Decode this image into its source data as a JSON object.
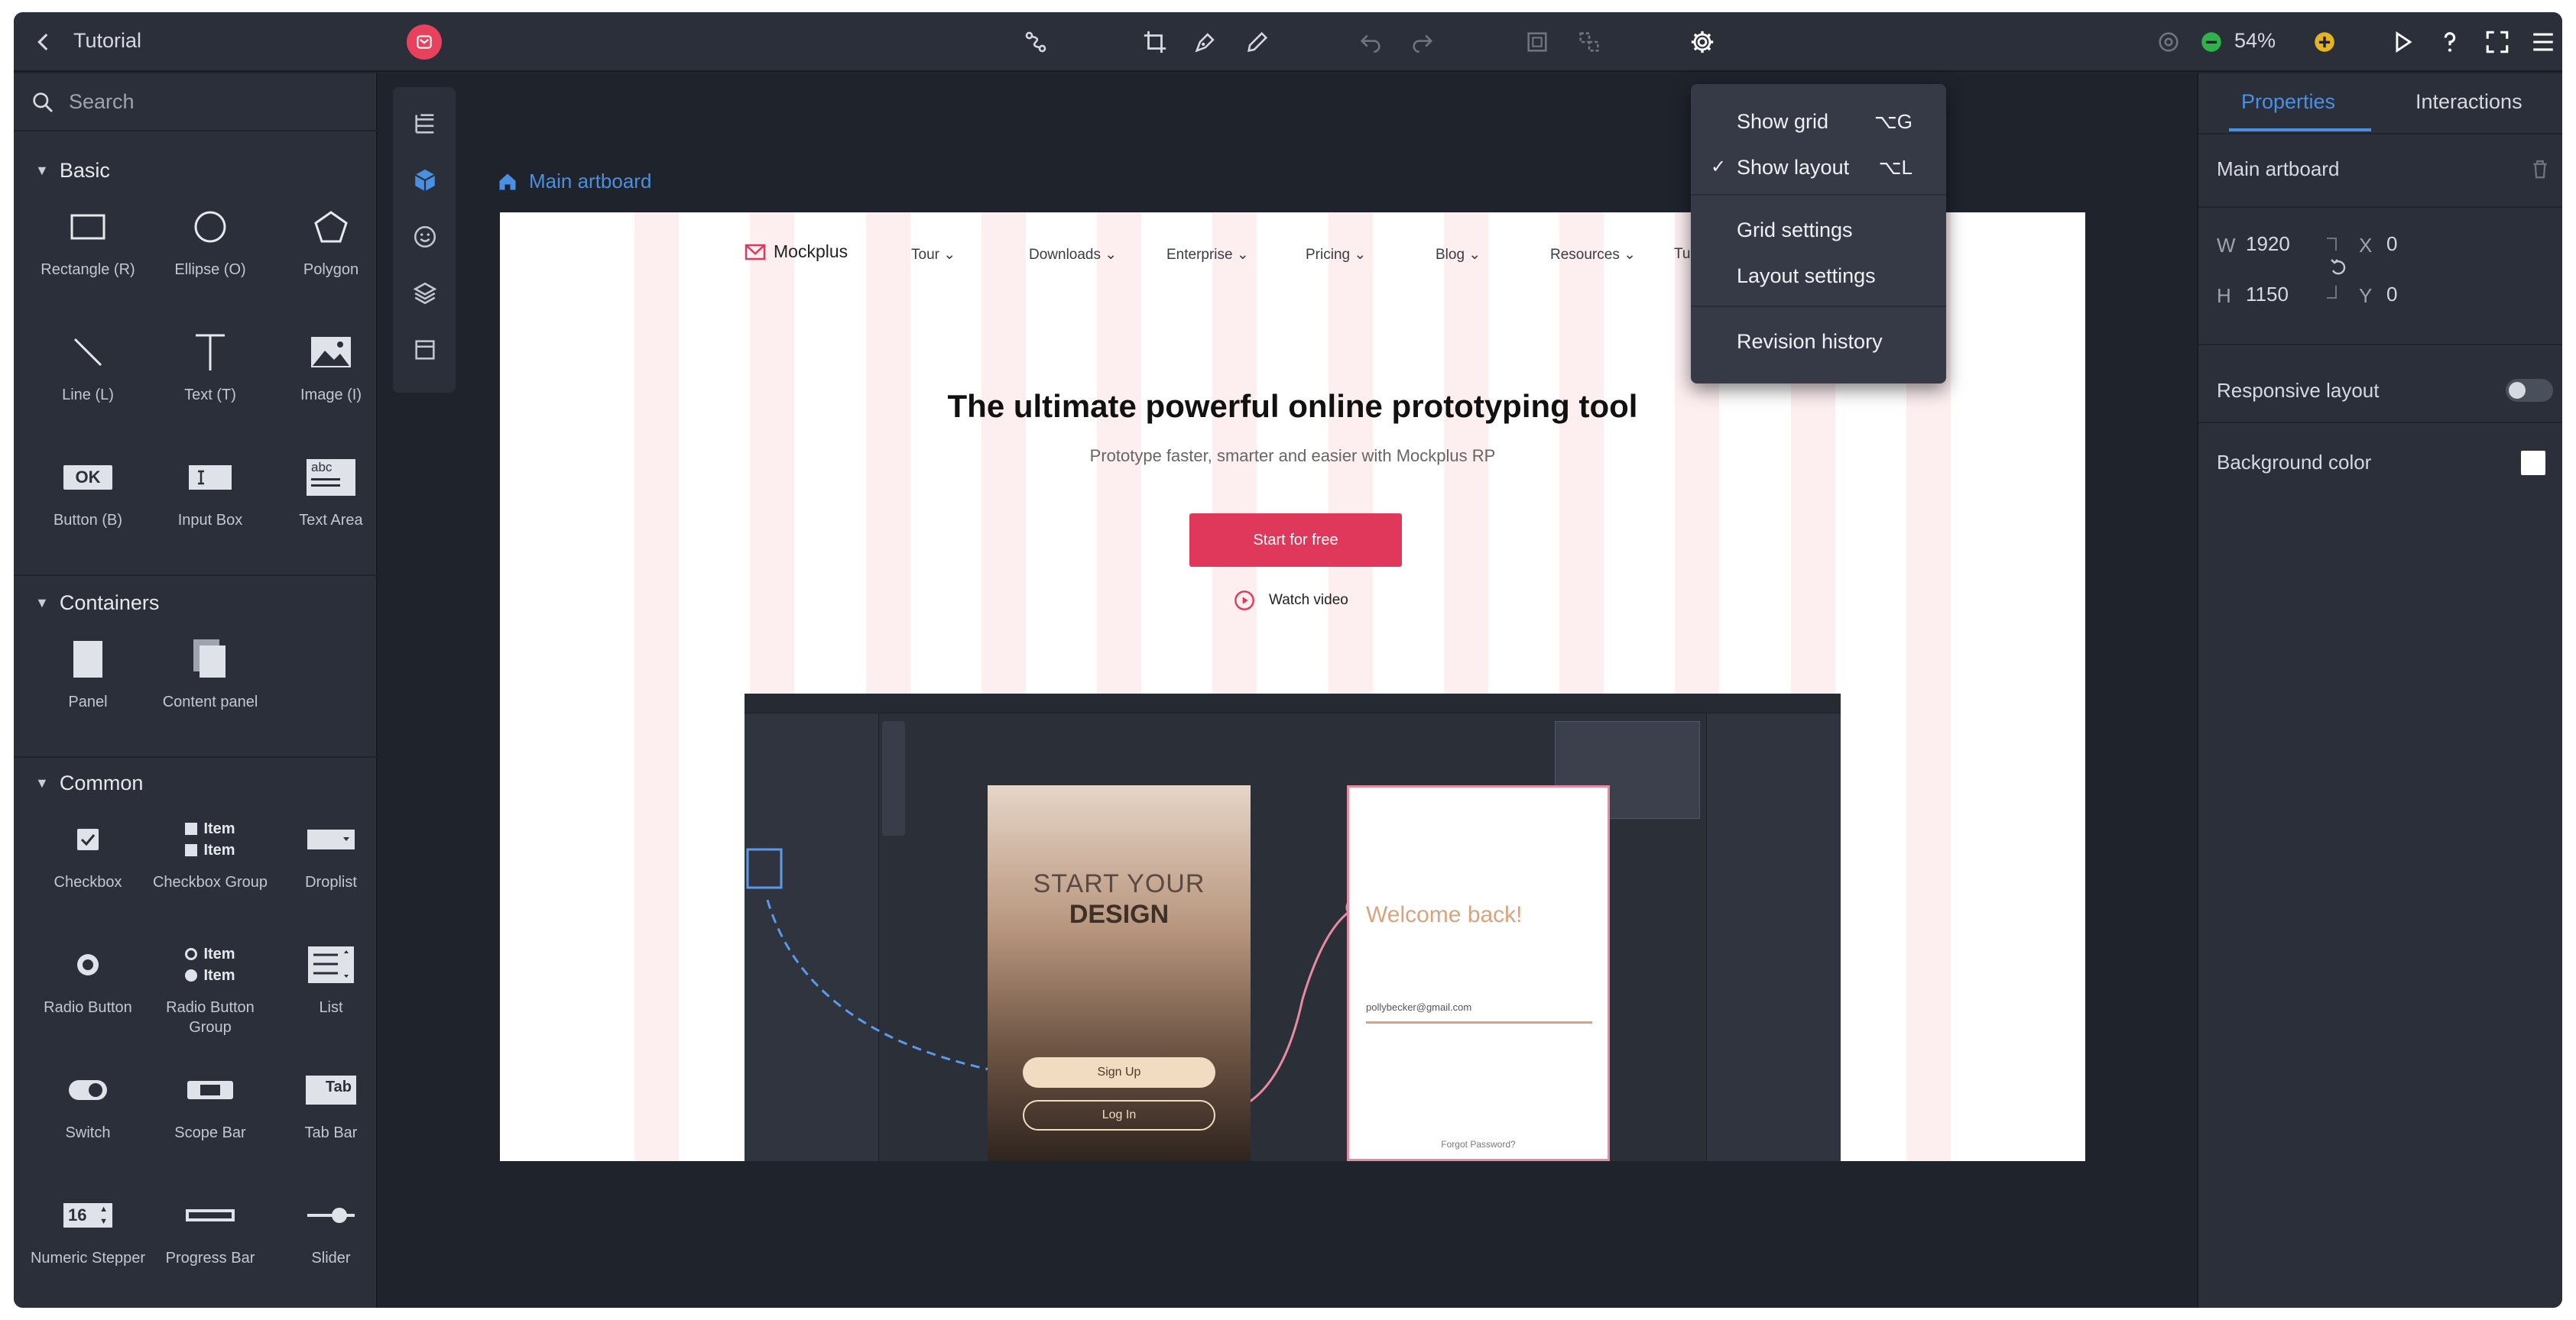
{
  "window": {
    "title": "Tutorial"
  },
  "toolbar": {
    "zoom_label": "54%",
    "accent_color": "#e8415e"
  },
  "left_panel": {
    "search_placeholder": "Search",
    "sections": [
      {
        "title": "Basic",
        "items": [
          "Rectangle (R)",
          "Ellipse (O)",
          "Polygon",
          "Line (L)",
          "Text (T)",
          "Image (I)",
          "Button (B)",
          "Input Box",
          "Text Area"
        ]
      },
      {
        "title": "Containers",
        "items": [
          "Panel",
          "Content panel"
        ]
      },
      {
        "title": "Common",
        "items": [
          "Checkbox",
          "Checkbox Group",
          "Droplist",
          "Radio Button",
          "Radio Button Group",
          "List",
          "Switch",
          "Scope Bar",
          "Tab Bar",
          "Numeric Stepper",
          "Progress Bar",
          "Slider"
        ]
      }
    ],
    "icon_text": {
      "button": "OK",
      "textarea": "abc",
      "tabbar": "Tab",
      "stepper": "16",
      "item": "Item"
    }
  },
  "canvas": {
    "artboard_name": "Main artboard",
    "site": {
      "brand": "Mockplus",
      "nav": [
        "Tour",
        "Downloads",
        "Enterprise",
        "Pricing",
        "Blog",
        "Resources",
        "Tu"
      ],
      "hero_title": "The ultimate powerful online prototyping tool",
      "hero_subtitle": "Prototype faster, smarter and easier with Mockplus RP",
      "cta": "Start for free",
      "watch": "Watch video",
      "phone1_line1": "START YOUR",
      "phone1_line2": "DESIGN",
      "sign_up": "Sign Up",
      "log_in": "Log In",
      "welcome": "Welcome back!",
      "email": "pollybecker@gmail.com",
      "forgot": "Forgot Password?"
    }
  },
  "settings_menu": {
    "items": [
      {
        "label": "Show grid",
        "shortcut": "⌥G",
        "checked": false
      },
      {
        "label": "Show layout",
        "shortcut": "⌥L",
        "checked": true
      },
      {
        "label": "Grid settings"
      },
      {
        "label": "Layout settings"
      },
      {
        "label": "Revision history"
      }
    ]
  },
  "right_panel": {
    "tabs": [
      "Properties",
      "Interactions"
    ],
    "active_tab": "Properties",
    "element_name": "Main artboard",
    "w_label": "W",
    "w_value": "1920",
    "h_label": "H",
    "h_value": "1150",
    "x_label": "X",
    "x_value": "0",
    "y_label": "Y",
    "y_value": "0",
    "responsive_label": "Responsive layout",
    "responsive_on": false,
    "bg_label": "Background color",
    "bg_color": "#ffffff"
  }
}
